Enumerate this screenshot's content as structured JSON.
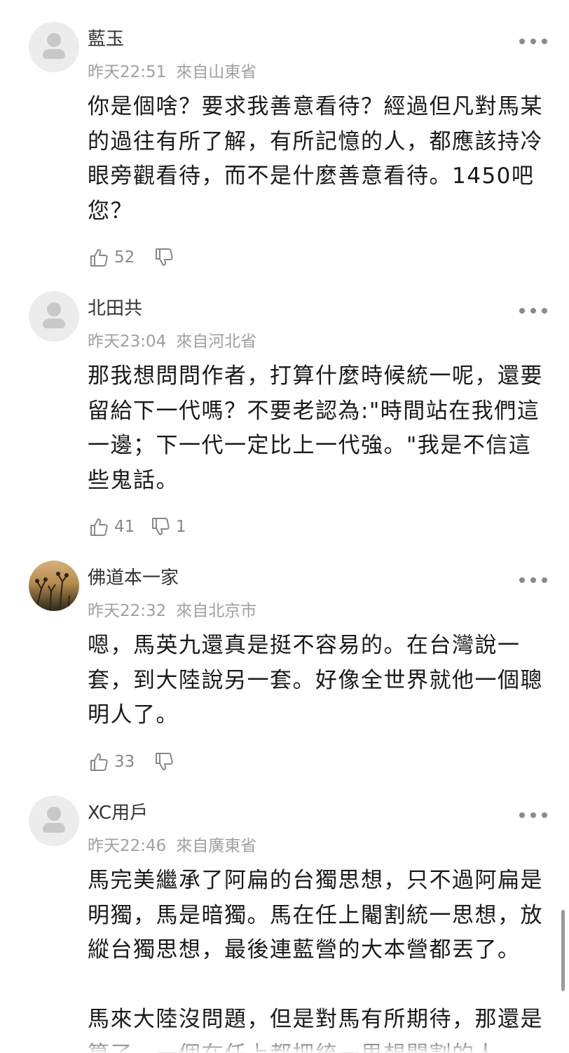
{
  "comments": [
    {
      "username": "藍玉",
      "time": "昨天22:51",
      "location": "來自山東省",
      "paragraphs": [
        "你是個啥？要求我善意看待？經過但凡對馬某的過往有所了解，有所記憶的人，都應該持冷眼旁觀看待，而不是什麼善意看待。1450吧您？"
      ],
      "likes": "52",
      "dislikes": ""
    },
    {
      "username": "北田共",
      "time": "昨天23:04",
      "location": "來自河北省",
      "paragraphs": [
        "那我想問問作者，打算什麼時候統一呢，還要留給下一代嗎？不要老認為:\"時間站在我們這一邊；下一代一定比上一代強。\"我是不信這些鬼話。"
      ],
      "likes": "41",
      "dislikes": "1"
    },
    {
      "username": "佛道本一家",
      "time": "昨天22:32",
      "location": "來自北京市",
      "paragraphs": [
        "嗯，馬英九還真是挺不容易的。在台灣說一套，到大陸說另一套。好像全世界就他一個聰明人了。"
      ],
      "likes": "33",
      "dislikes": ""
    },
    {
      "username": "XC用戶",
      "time": "昨天22:46",
      "location": "來自廣東省",
      "paragraphs": [
        "馬完美繼承了阿扁的台獨思想，只不過阿扁是明獨，馬是暗獨。馬在任上閹割統一思想，放縱台獨思想，最後連藍營的大本營都丟了。",
        "馬來大陸沒問題，但是對馬有所期待，那還是算了。一個在任上都把統一思想閹割的人"
      ]
    }
  ],
  "icons": {
    "like": "thumbs-up-icon",
    "dislike": "thumbs-down-icon",
    "more": "more-dots-icon",
    "avatar": "default-avatar-icon"
  },
  "colors": {
    "meta": "#a0a0a0",
    "text": "#1a1a1a",
    "icon": "#888888"
  }
}
